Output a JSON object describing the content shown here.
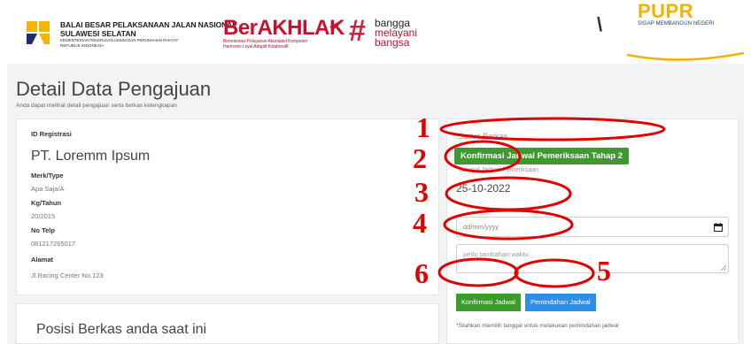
{
  "header": {
    "bbp_line1": "BALAI BESAR PELAKSANAAN JALAN NASIONAL",
    "bbp_line2": "SULAWESI SELATAN",
    "bbp_line3": "KEMENTERIAN PEKERJAAN UMUM DAN PERUMAHAN RAKYAT",
    "bbp_line4": "REPUBLIK INDONESIA",
    "berakhlak_word": "BerAKHLAK",
    "berakhlak_sub1": "Berorientasi Pelayanan Akuntabel Kompeten",
    "berakhlak_sub2": "Harmonis Loyal Adaptif Kolaboratif",
    "bangga_hash": "#",
    "bangga_lines": [
      "bangga",
      "melayani",
      "bangsa"
    ],
    "paren": "\\",
    "pupr_word": "PUPR",
    "pupr_sub": "SIGAP MEMBANGUN NEGERI"
  },
  "page": {
    "title": "Detail Data Pengajuan",
    "subtitle": "Anda dapat melihat detail pengajuan serta berkas kelengkapan"
  },
  "detail": {
    "id_label": "ID Registrasi",
    "company": "PT. Loremm Ipsum",
    "merk_label": "Merk/Type",
    "merk_value": "Apa Saja/A",
    "kg_label": "Kg/Tahun",
    "kg_value": "20/2015",
    "telp_label": "No Telp",
    "telp_value": "081217265017",
    "alamat_label": "Alamat",
    "alamat_value": "Jl.Racing Center No.123"
  },
  "position": {
    "title": "Posisi Berkas anda saat ini"
  },
  "status": {
    "label": "Status Berkas",
    "badge": "Konfirmasi Jadwal Pemeriksaan Tahap 2",
    "date_label": "Tanggal Jadwal Pemeriksaan",
    "date_value": "25-10-2022",
    "date_placeholder": "dd/mm/yyyy",
    "textarea_placeholder": "perlu tambahan waktu",
    "btn_confirm": "Konfirmasi Jadwal",
    "btn_move": "Pemindahan Jadwal",
    "note": "*Silahkan memilih tanggal untuk melakukan pemindahan jadwal"
  },
  "annotations": {
    "numbers": [
      "1",
      "2",
      "3",
      "4",
      "5",
      "6"
    ],
    "color": "#e10000"
  },
  "colors": {
    "accent_green": "#3d9b2d",
    "accent_blue": "#2f8fe6",
    "brand_red": "#c8102e",
    "pupr_yellow": "#f0b400"
  }
}
